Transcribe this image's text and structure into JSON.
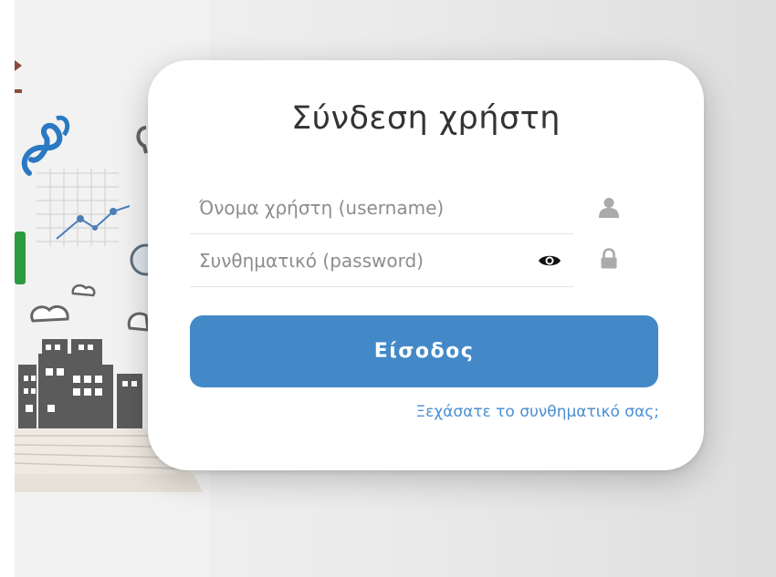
{
  "login": {
    "title": "Σύνδεση χρήστη",
    "username_placeholder": "Όνομα χρήστη (username)",
    "password_placeholder": "Συνθηματικό (password)",
    "submit_label": "Είσοδος",
    "forgot_password_label": "Ξεχάσατε το συνθηματικό σας;"
  },
  "icons": {
    "username": "user-icon",
    "password": "lock-icon",
    "toggle": "eye-icon"
  },
  "colors": {
    "button": "#4389c8",
    "link": "#4a8fd0",
    "title": "#333333",
    "placeholder": "#8d8d8d",
    "icon": "#aaaaaa"
  }
}
